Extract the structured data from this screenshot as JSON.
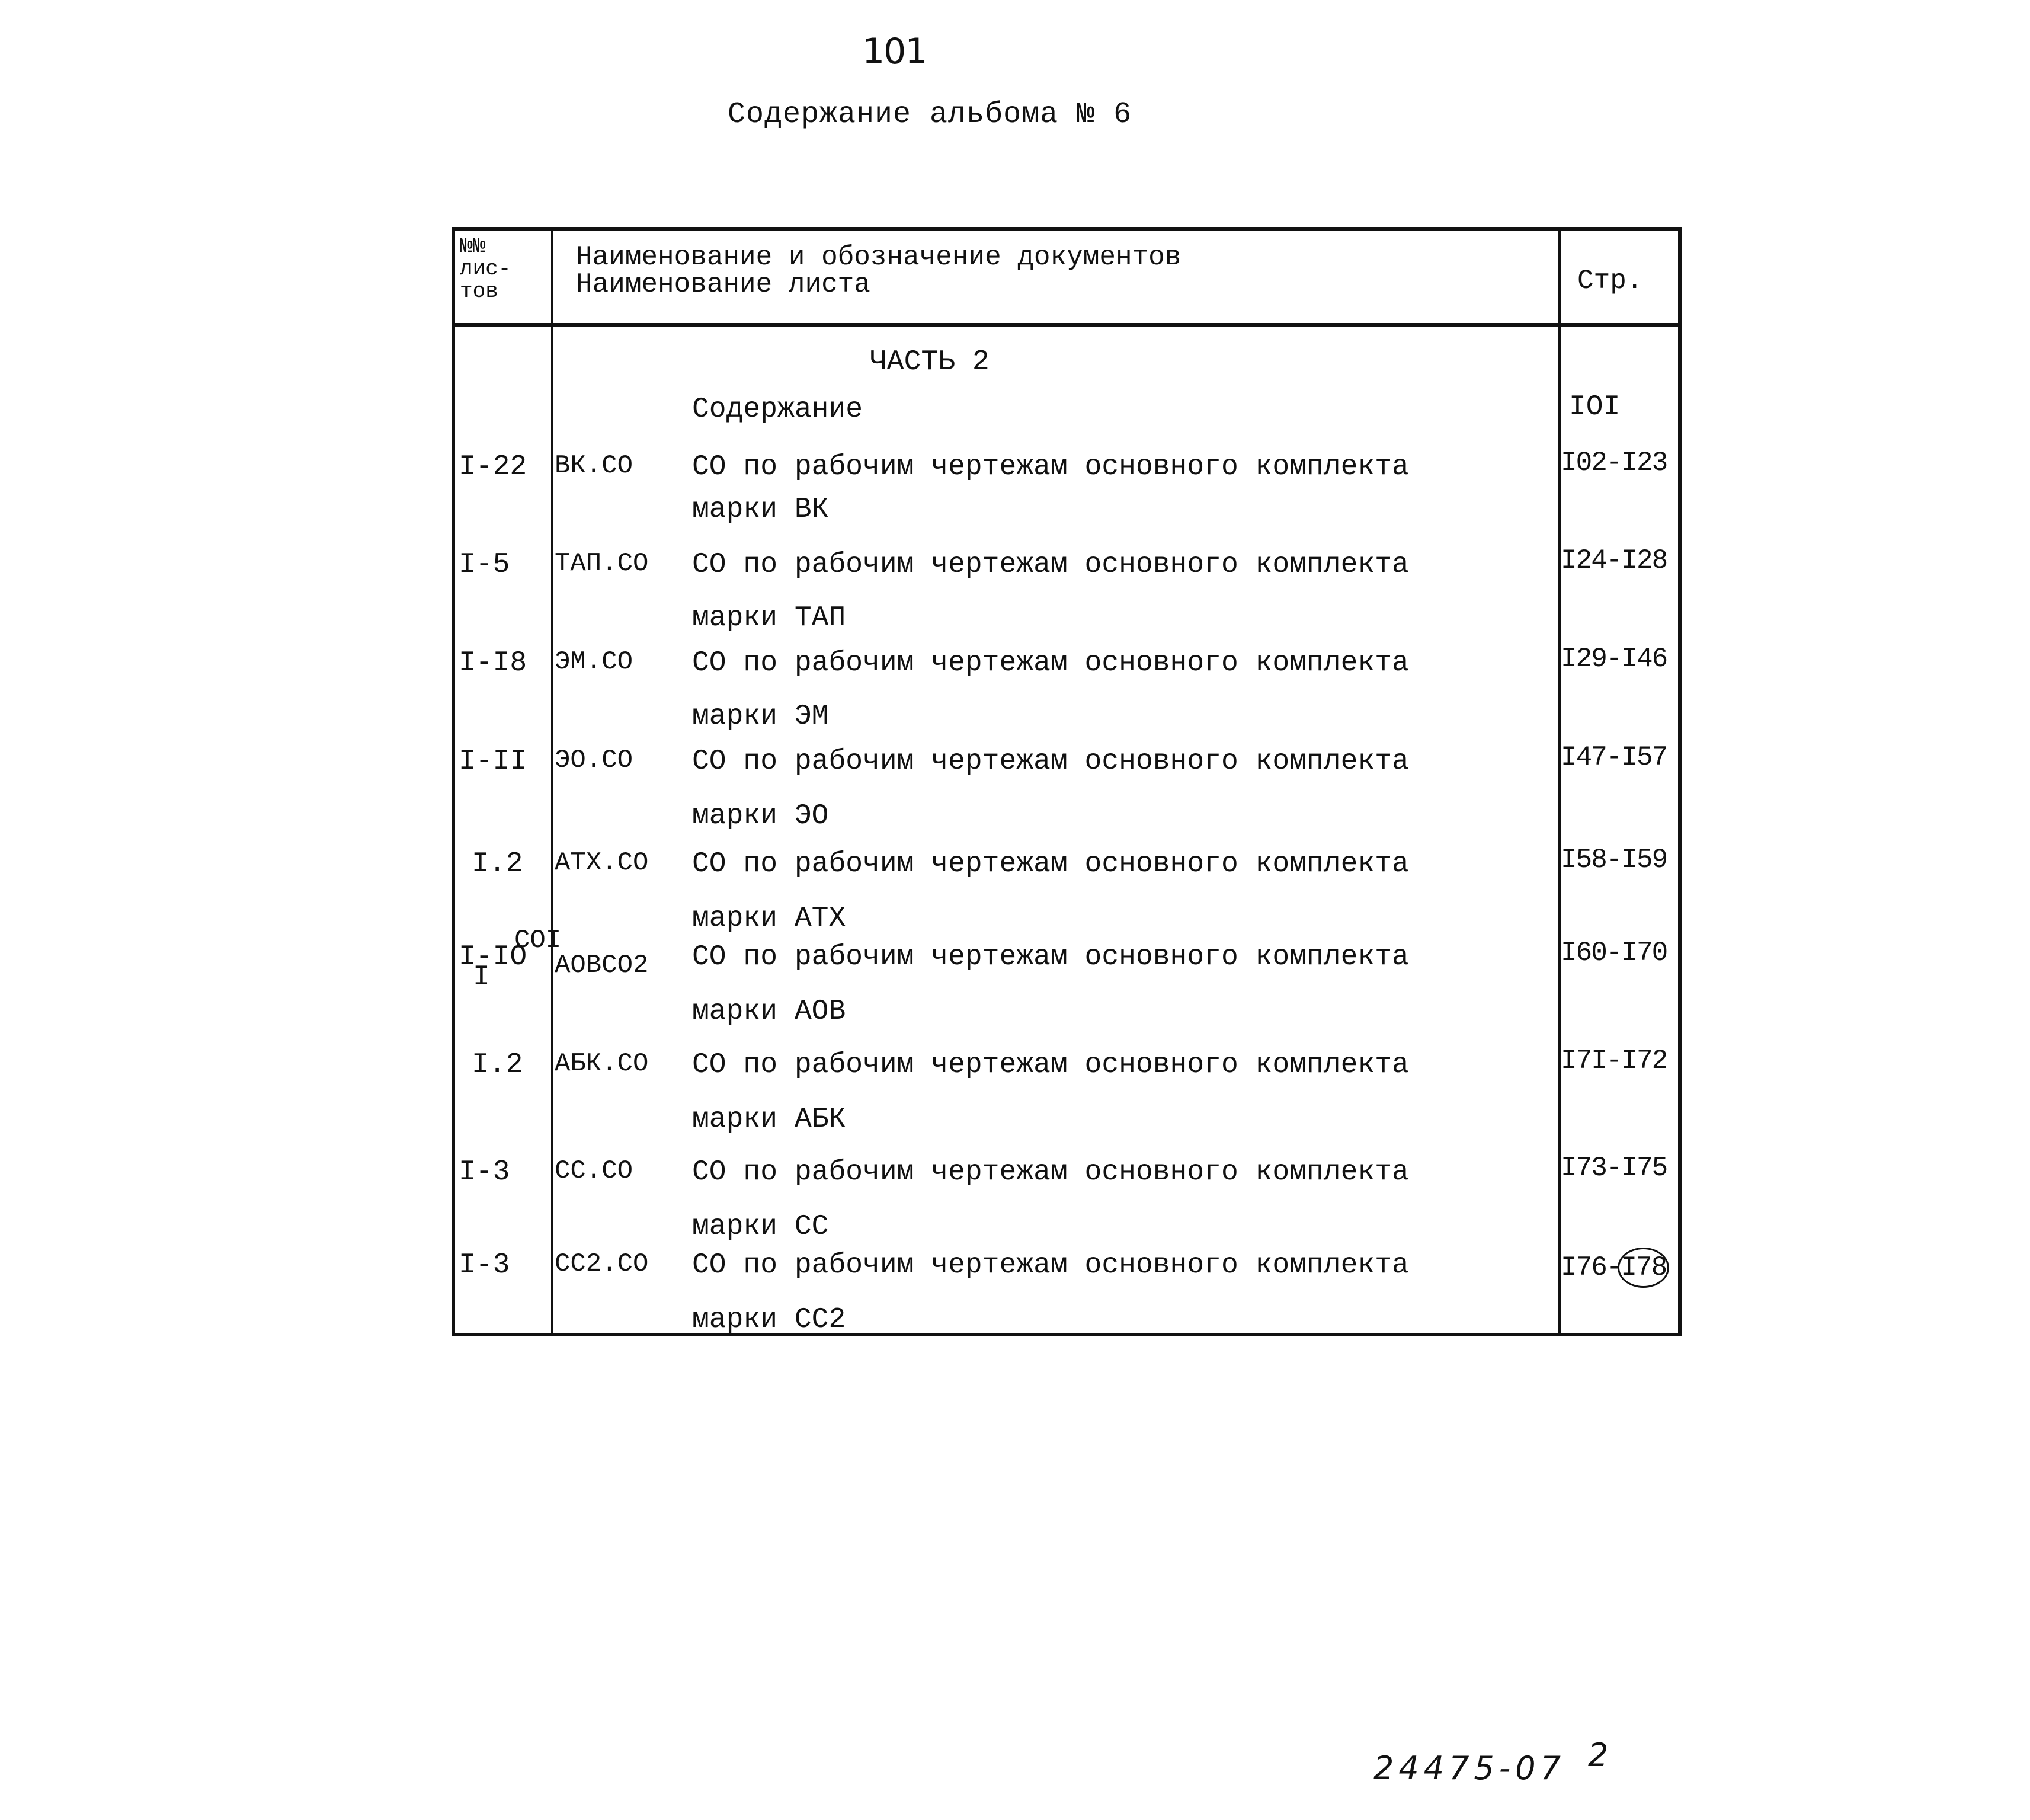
{
  "page_number": "101",
  "title": "Содержание альбома № 6",
  "table": {
    "headers": {
      "sheets_col": [
        "№№",
        "лис-",
        "тов"
      ],
      "name_col": [
        "Наименование и обозначение документов",
        "Наименование листа"
      ],
      "page_col": "Стр."
    },
    "section_title": "ЧАСТЬ 2",
    "contents_row": {
      "name": "Содержание",
      "page": "IOI"
    },
    "rows": [
      {
        "sheets": "I-22",
        "code": "ВК.СО",
        "line1": "СО по рабочим чертежам основного комплекта",
        "line2": "марки ВК",
        "pages": "I02-I23"
      },
      {
        "sheets": "I-5",
        "code": "ТАП.СО",
        "line1": "СО по рабочим чертежам основного комплекта",
        "line2": "марки ТАП",
        "pages": "I24-I28"
      },
      {
        "sheets": "I-I8",
        "code": "ЭМ.СО",
        "line1": "СО по рабочим чертежам основного комплекта",
        "line2": "марки ЭМ",
        "pages": "I29-I46"
      },
      {
        "sheets": "I-II",
        "code": "ЭО.СО",
        "line1": "СО по рабочим чертежам основного комплекта",
        "line2": "марки ЭО",
        "pages": "I47-I57"
      },
      {
        "sheets": "I.2",
        "code": "АТХ.СО",
        "line1": "СО по рабочим чертежам основного комплекта",
        "line2": "марки АТХ",
        "pages": "I58-I59"
      },
      {
        "sheets": "I-IO",
        "sheets_sub": "I",
        "code": "СОI",
        "code_sub": "АОВСО2",
        "line1": "СО по рабочим чертежам основного комплекта",
        "line2": "марки АОВ",
        "pages": "I60-I70"
      },
      {
        "sheets": "I.2",
        "code": "АБК.СО",
        "line1": "СО по рабочим чертежам основного комплекта",
        "line2": "марки АБК",
        "pages": "I7I-I72"
      },
      {
        "sheets": "I-3",
        "code": "СС.СО",
        "line1": "СО по рабочим чертежам основного комплекта",
        "line2": "марки СС",
        "pages": "I73-I75"
      },
      {
        "sheets": "I-3",
        "code": "СС2.СО",
        "line1": "СО по рабочим чертежам основного комплекта",
        "line2": "марки СС2",
        "pages_start": "I76-",
        "pages_end_circled": "I78"
      }
    ]
  },
  "footer": {
    "code": "24475-07",
    "sheet": "2"
  }
}
